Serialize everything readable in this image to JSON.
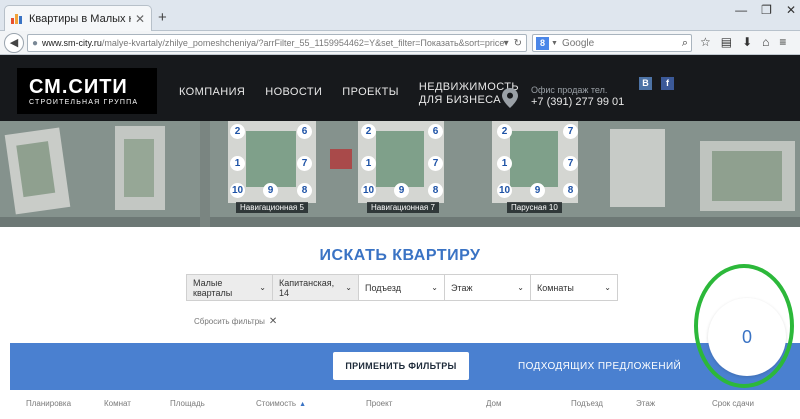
{
  "browser": {
    "tab_title": "Квартиры в Малых кварта...",
    "url_host": "www.sm-city.ru",
    "url_path": "/malye-kvartaly/zhilye_pomeshcheniya/?arrFilter_55_1159954462=Y&set_filter=Показать&sort=price&order=asc&",
    "search_placeholder": "Google",
    "search_engine_icon": "google-icon"
  },
  "header": {
    "logo_main": "СМ.СИТИ",
    "logo_sub": "СТРОИТЕЛЬНАЯ ГРУППА",
    "menu": [
      "КОМПАНИЯ",
      "НОВОСТИ",
      "ПРОЕКТЫ",
      "НЕДВИЖИМОСТЬ\nДЛЯ БИЗНЕСА"
    ],
    "office_label": "Офис продаж тел.",
    "office_phone": "+7 (391) 277 99 01",
    "social": [
      "В",
      "f"
    ]
  },
  "map": {
    "labels": [
      "Навигационная 5",
      "Навигационная 7",
      "Парусная 10"
    ],
    "numbers": [
      "2",
      "6",
      "1",
      "7",
      "10",
      "9",
      "8",
      "2",
      "6",
      "1",
      "7",
      "10",
      "9",
      "8",
      "2",
      "7",
      "1",
      "7",
      "10",
      "9",
      "8"
    ]
  },
  "search": {
    "title": "ИСКАТЬ КВАРТИРУ",
    "filters": [
      {
        "label": "Малые кварталы",
        "active": true
      },
      {
        "label": "Капитанская, 14",
        "active": true
      },
      {
        "label": "Подъезд",
        "active": false
      },
      {
        "label": "Этаж",
        "active": false
      },
      {
        "label": "Комнаты",
        "active": false
      }
    ],
    "reset_label": "Сбросить фильтры"
  },
  "results": {
    "apply_label": "ПРИМЕНИТЬ ФИЛЬТРЫ",
    "offers_label": "ПОДХОДЯЩИХ ПРЕДЛОЖЕНИЙ",
    "count": "0"
  },
  "table": {
    "columns": [
      "Планировка",
      "Комнат",
      "Площадь",
      "Стоимость",
      "Проект",
      "Дом",
      "Подъезд",
      "Этаж",
      "Срок сдачи"
    ]
  },
  "colors": {
    "accent": "#3a73c4",
    "blue_bar": "#4a80d0",
    "header_bg": "#17191c",
    "annotation": "#2cb83a"
  }
}
